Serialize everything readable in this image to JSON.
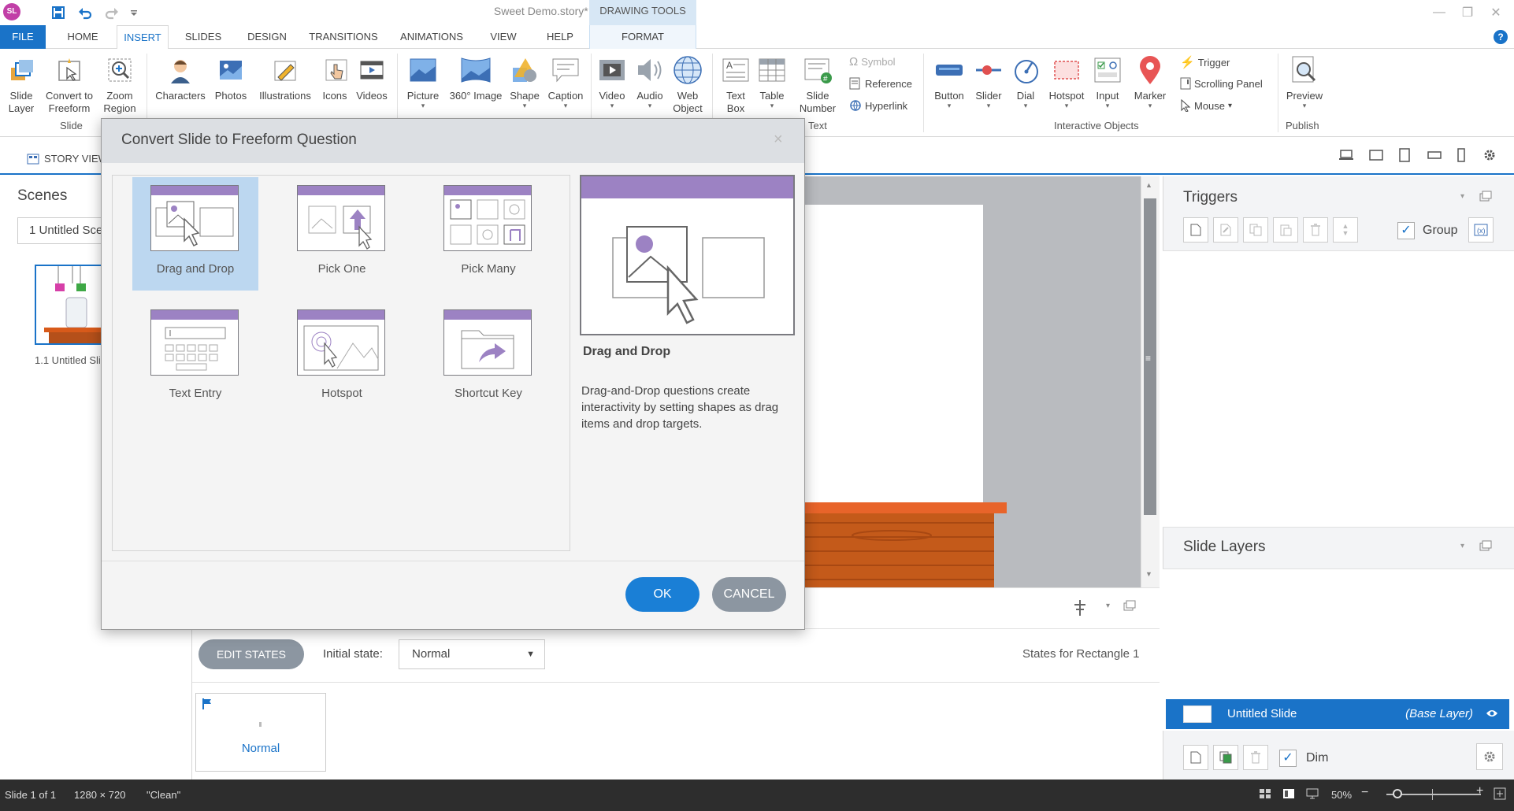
{
  "app": {
    "logo": "SL",
    "title": "Sweet Demo.story* -  Articulate Storyline",
    "context_tab_group": "DRAWING TOOLS"
  },
  "tabs": [
    "FILE",
    "HOME",
    "INSERT",
    "SLIDES",
    "DESIGN",
    "TRANSITIONS",
    "ANIMATIONS",
    "VIEW",
    "HELP"
  ],
  "context_tab": "FORMAT",
  "active_tab": "INSERT",
  "help": "?",
  "ribbon": {
    "slide_group": {
      "label": "Slide",
      "items": [
        "Slide\nLayer",
        "Convert to\nFreeform",
        "Zoom\nRegion"
      ]
    },
    "media_items": [
      "Characters",
      "Photos",
      "Illustrations",
      "Icons",
      "Videos"
    ],
    "picture_items": [
      "Picture",
      "360° Image",
      "Shape",
      "Caption"
    ],
    "video_items": [
      "Video",
      "Audio",
      "Web\nObject"
    ],
    "text_group": {
      "label": "Text",
      "items": [
        "Text\nBox",
        "Table",
        "Slide\nNumber"
      ],
      "small": [
        "Symbol",
        "Reference",
        "Hyperlink"
      ]
    },
    "interactive_group": {
      "label": "Interactive Objects",
      "items": [
        "Button",
        "Slider",
        "Dial",
        "Hotspot",
        "Input",
        "Marker"
      ],
      "small": [
        "Trigger",
        "Scrolling Panel",
        "Mouse"
      ]
    },
    "publish_group": {
      "label": "Publish",
      "items": [
        "Preview"
      ]
    }
  },
  "view": {
    "story_view": "STORY VIEW"
  },
  "scenes": {
    "title": "Scenes",
    "selected": "1 Untitled Scene",
    "slide_caption": "1.1 Untitled Slide"
  },
  "states": {
    "edit_button": "EDIT STATES",
    "initial_label": "Initial state:",
    "initial_value": "Normal",
    "states_for": "States for Rectangle 1",
    "state_card_label": "Normal"
  },
  "triggers": {
    "title": "Triggers",
    "group_label": "Group",
    "group_checked": true
  },
  "layers": {
    "title": "Slide Layers",
    "base_name": "Untitled Slide",
    "base_tag": "(Base Layer)",
    "dim_label": "Dim",
    "dim_checked": true
  },
  "status": {
    "slide": "Slide 1 of 1",
    "size": "1280 × 720",
    "theme": "\"Clean\"",
    "zoom": "50%"
  },
  "dialog": {
    "title": "Convert Slide to Freeform Question",
    "options": [
      "Drag and Drop",
      "Pick One",
      "Pick Many",
      "Text Entry",
      "Hotspot",
      "Shortcut Key"
    ],
    "selected": "Drag and Drop",
    "preview_title": "Drag and Drop",
    "preview_desc": "Drag-and-Drop questions create interactivity by setting shapes as drag items and drop targets.",
    "ok": "OK",
    "cancel": "CANCEL"
  },
  "colors": {
    "accent": "#1a73c8",
    "purple": "#9c82c3",
    "gray_button": "#8c96a1",
    "status_bar": "#2d2d2d"
  }
}
